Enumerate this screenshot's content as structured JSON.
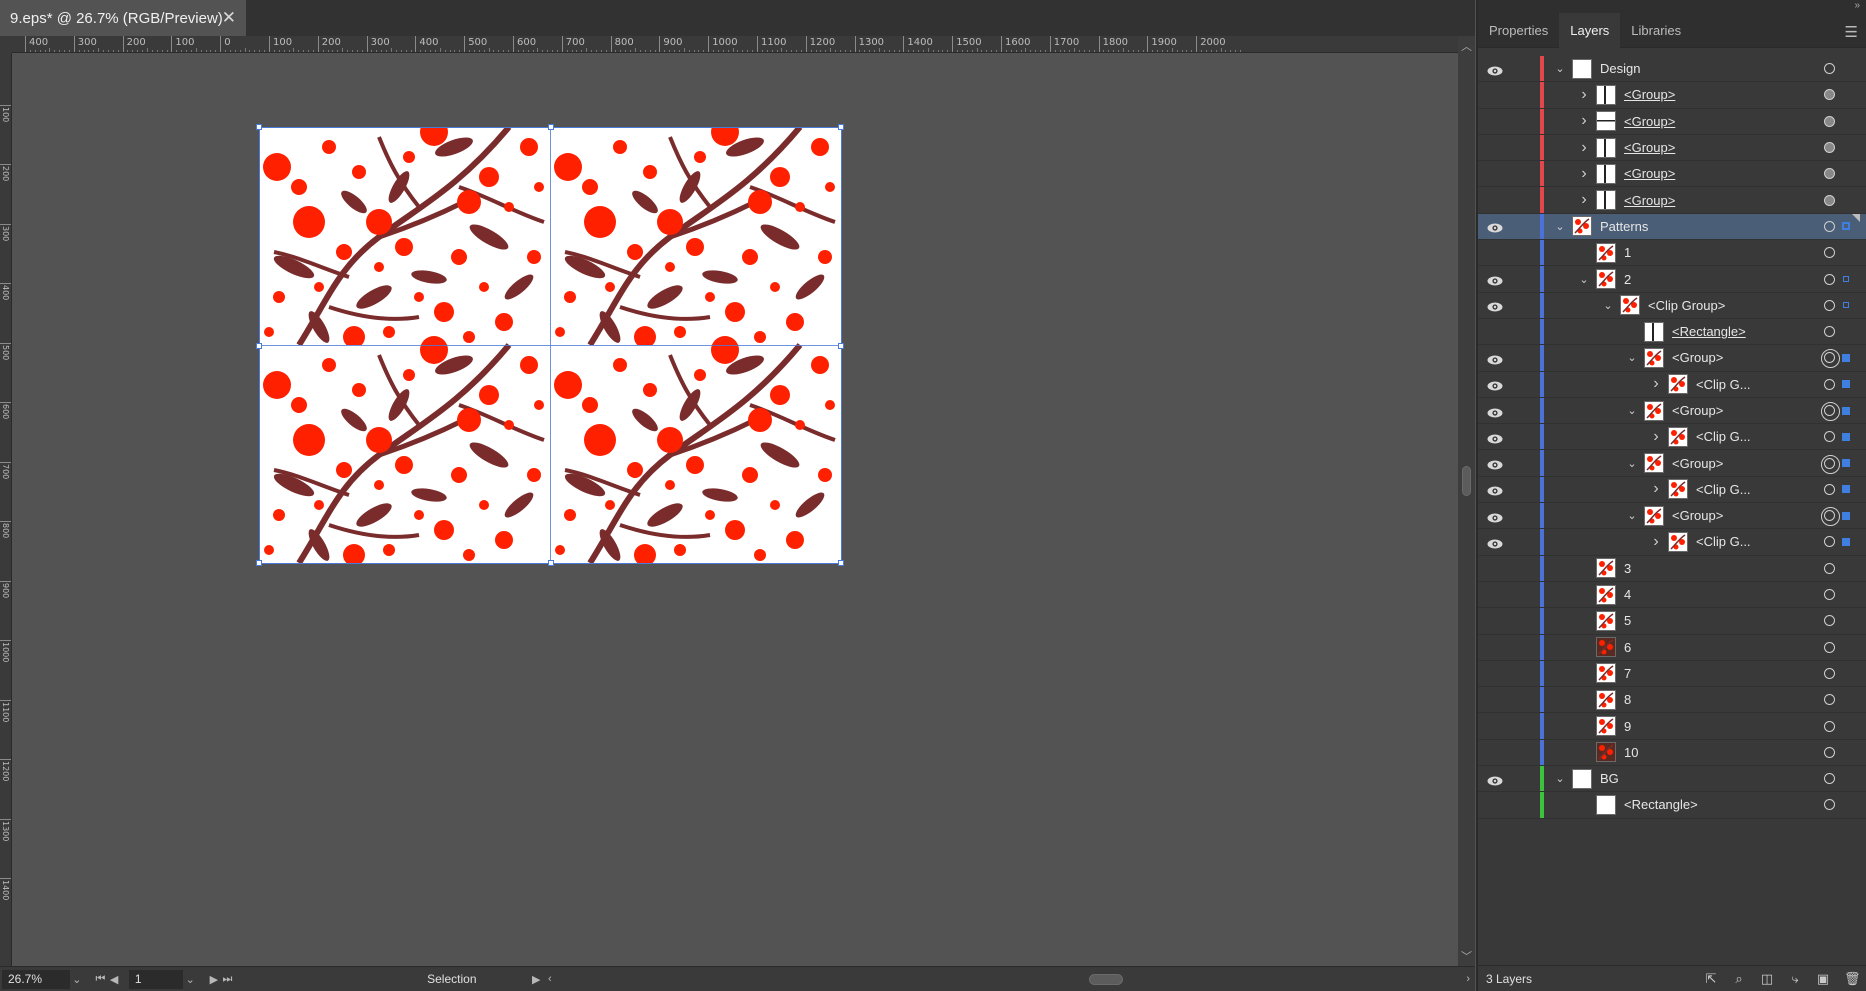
{
  "document": {
    "tab_title": "9.eps* @ 26.7% (RGB/Preview)",
    "close_glyph": "✕"
  },
  "rulers": {
    "top_labels": [
      "400",
      "300",
      "200",
      "100",
      "0",
      "100",
      "200",
      "300",
      "400",
      "500",
      "600",
      "700",
      "800",
      "900",
      "1000",
      "1100",
      "1200",
      "1300",
      "1400",
      "1500",
      "1600",
      "1700",
      "1800",
      "1900",
      "2000"
    ],
    "left_labels": [
      "0",
      "100",
      "200",
      "300",
      "400",
      "500",
      "600",
      "700",
      "800",
      "900",
      "1000",
      "1100",
      "1200",
      "1300",
      "1400"
    ]
  },
  "statusbar": {
    "zoom": "26.7%",
    "page": "1",
    "status_text": "Selection"
  },
  "panel": {
    "tabs": [
      "Properties",
      "Layers",
      "Libraries"
    ],
    "active_tab": "Layers",
    "layer_count": "3 Layers"
  },
  "layers": [
    {
      "label": "Design",
      "depth": 0,
      "eye": true,
      "chev": "down",
      "thumb": "white",
      "target": "o",
      "color": "#e0484b",
      "sel": false,
      "ul": false,
      "selsq": "none"
    },
    {
      "label": "<Group>",
      "depth": 1,
      "eye": false,
      "chev": "right",
      "thumb": "white-bar",
      "target": "filled",
      "color": "#e0484b",
      "sel": false,
      "ul": true,
      "selsq": "none"
    },
    {
      "label": "<Group>",
      "depth": 1,
      "eye": false,
      "chev": "right",
      "thumb": "white-line",
      "target": "filled",
      "color": "#e0484b",
      "sel": false,
      "ul": true,
      "selsq": "none"
    },
    {
      "label": "<Group>",
      "depth": 1,
      "eye": false,
      "chev": "right",
      "thumb": "white-bar",
      "target": "filled",
      "color": "#e0484b",
      "sel": false,
      "ul": true,
      "selsq": "none"
    },
    {
      "label": "<Group>",
      "depth": 1,
      "eye": false,
      "chev": "right",
      "thumb": "white-bar",
      "target": "filled",
      "color": "#e0484b",
      "sel": false,
      "ul": true,
      "selsq": "none"
    },
    {
      "label": "<Group>",
      "depth": 1,
      "eye": false,
      "chev": "right",
      "thumb": "white-bar",
      "target": "filled",
      "color": "#e0484b",
      "sel": false,
      "ul": true,
      "selsq": "none"
    },
    {
      "label": "Patterns",
      "depth": 0,
      "eye": true,
      "chev": "down",
      "thumb": "pattern",
      "target": "o",
      "color": "#4a72d8",
      "sel": true,
      "ul": false,
      "selsq": "hollow"
    },
    {
      "label": "1",
      "depth": 1,
      "eye": false,
      "chev": "none",
      "thumb": "pattern",
      "target": "o",
      "color": "#4a72d8",
      "sel": false,
      "ul": false,
      "selsq": "none"
    },
    {
      "label": "2",
      "depth": 1,
      "eye": true,
      "chev": "down",
      "thumb": "pattern",
      "target": "o",
      "color": "#4a72d8",
      "sel": false,
      "ul": false,
      "selsq": "small"
    },
    {
      "label": "<Clip Group>",
      "depth": 2,
      "eye": true,
      "chev": "down",
      "thumb": "pattern",
      "target": "o",
      "color": "#4a72d8",
      "sel": false,
      "ul": false,
      "selsq": "small"
    },
    {
      "label": "<Rectangle>",
      "depth": 3,
      "eye": false,
      "chev": "none",
      "thumb": "white-bar",
      "target": "o",
      "color": "#4a72d8",
      "sel": false,
      "ul": true,
      "selsq": "none"
    },
    {
      "label": "<Group>",
      "depth": 3,
      "eye": true,
      "chev": "down",
      "thumb": "pattern",
      "target": "dbl",
      "color": "#4a72d8",
      "sel": false,
      "ul": false,
      "selsq": "full"
    },
    {
      "label": "<Clip G...",
      "depth": 4,
      "eye": true,
      "chev": "right",
      "thumb": "pattern",
      "target": "o",
      "color": "#4a72d8",
      "sel": false,
      "ul": false,
      "selsq": "full"
    },
    {
      "label": "<Group>",
      "depth": 3,
      "eye": true,
      "chev": "down",
      "thumb": "pattern",
      "target": "dbl",
      "color": "#4a72d8",
      "sel": false,
      "ul": false,
      "selsq": "full"
    },
    {
      "label": "<Clip G...",
      "depth": 4,
      "eye": true,
      "chev": "right",
      "thumb": "pattern",
      "target": "o",
      "color": "#4a72d8",
      "sel": false,
      "ul": false,
      "selsq": "full"
    },
    {
      "label": "<Group>",
      "depth": 3,
      "eye": true,
      "chev": "down",
      "thumb": "pattern",
      "target": "dbl",
      "color": "#4a72d8",
      "sel": false,
      "ul": false,
      "selsq": "full"
    },
    {
      "label": "<Clip G...",
      "depth": 4,
      "eye": true,
      "chev": "right",
      "thumb": "pattern",
      "target": "o",
      "color": "#4a72d8",
      "sel": false,
      "ul": false,
      "selsq": "full"
    },
    {
      "label": "<Group>",
      "depth": 3,
      "eye": true,
      "chev": "down",
      "thumb": "pattern",
      "target": "dbl",
      "color": "#4a72d8",
      "sel": false,
      "ul": false,
      "selsq": "full"
    },
    {
      "label": "<Clip G...",
      "depth": 4,
      "eye": true,
      "chev": "right",
      "thumb": "pattern",
      "target": "o",
      "color": "#4a72d8",
      "sel": false,
      "ul": false,
      "selsq": "full"
    },
    {
      "label": "3",
      "depth": 1,
      "eye": false,
      "chev": "none",
      "thumb": "pattern",
      "target": "o",
      "color": "#4a72d8",
      "sel": false,
      "ul": false,
      "selsq": "none"
    },
    {
      "label": "4",
      "depth": 1,
      "eye": false,
      "chev": "none",
      "thumb": "pattern",
      "target": "o",
      "color": "#4a72d8",
      "sel": false,
      "ul": false,
      "selsq": "none"
    },
    {
      "label": "5",
      "depth": 1,
      "eye": false,
      "chev": "none",
      "thumb": "pattern",
      "target": "o",
      "color": "#4a72d8",
      "sel": false,
      "ul": false,
      "selsq": "none"
    },
    {
      "label": "6",
      "depth": 1,
      "eye": false,
      "chev": "none",
      "thumb": "pattern-dark",
      "target": "o",
      "color": "#4a72d8",
      "sel": false,
      "ul": false,
      "selsq": "none"
    },
    {
      "label": "7",
      "depth": 1,
      "eye": false,
      "chev": "none",
      "thumb": "pattern",
      "target": "o",
      "color": "#4a72d8",
      "sel": false,
      "ul": false,
      "selsq": "none"
    },
    {
      "label": "8",
      "depth": 1,
      "eye": false,
      "chev": "none",
      "thumb": "pattern",
      "target": "o",
      "color": "#4a72d8",
      "sel": false,
      "ul": false,
      "selsq": "none"
    },
    {
      "label": "9",
      "depth": 1,
      "eye": false,
      "chev": "none",
      "thumb": "pattern",
      "target": "o",
      "color": "#4a72d8",
      "sel": false,
      "ul": false,
      "selsq": "none"
    },
    {
      "label": "10",
      "depth": 1,
      "eye": false,
      "chev": "none",
      "thumb": "pattern-dark",
      "target": "o",
      "color": "#4a72d8",
      "sel": false,
      "ul": false,
      "selsq": "none"
    },
    {
      "label": "BG",
      "depth": 0,
      "eye": true,
      "chev": "down",
      "thumb": "white",
      "target": "o",
      "color": "#3ec23e",
      "sel": false,
      "ul": false,
      "selsq": "none"
    },
    {
      "label": "<Rectangle>",
      "depth": 1,
      "eye": false,
      "chev": "none",
      "thumb": "white",
      "target": "o",
      "color": "#3ec23e",
      "sel": false,
      "ul": false,
      "selsq": "none"
    }
  ],
  "colors": {
    "accent": "#4a79d8",
    "berry": "#ff2000",
    "stem": "#7a2c2c",
    "selected_row": "#4b5e78"
  },
  "icons": [
    "eye-icon",
    "chevron-down-icon",
    "chevron-right-icon",
    "target-icon",
    "close-icon",
    "hamburger-menu-icon",
    "new-layer-icon",
    "delete-icon",
    "locate-object-icon",
    "collect-export-icon",
    "clipping-mask-icon",
    "sublayer-icon"
  ]
}
